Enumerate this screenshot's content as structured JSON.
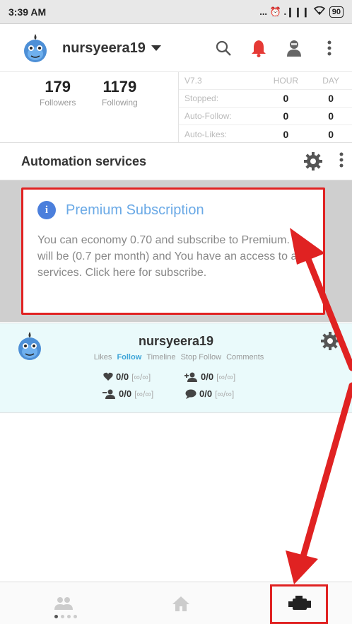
{
  "status_bar": {
    "time": "3:39 AM",
    "signal": "... ⏰ .❙❙❙",
    "battery": "90"
  },
  "header": {
    "username": "nursyeera19"
  },
  "stats": {
    "followers_count": "179",
    "followers_label": "Followers",
    "following_count": "1179",
    "following_label": "Following"
  },
  "table": {
    "version": "V7.3",
    "col_hour": "HOUR",
    "col_day": "DAY",
    "rows": [
      {
        "label": "Stopped:",
        "hour": "0",
        "day": "0"
      },
      {
        "label": "Auto-Follow:",
        "hour": "0",
        "day": "0"
      },
      {
        "label": "Auto-Likes:",
        "hour": "0",
        "day": "0"
      }
    ]
  },
  "section": {
    "title": "Automation services"
  },
  "premium": {
    "title": "Premium Subscription",
    "body": "You can economy 0.70 and subscribe to Premium. It will be (0.7 per month) and You have an access to all services. Click here for subscribe."
  },
  "account": {
    "username": "nursyeera19",
    "tabs": [
      "Likes",
      "Follow",
      "Timeline",
      "Stop Follow",
      "Comments"
    ],
    "active_tab": "Follow",
    "metrics": {
      "likes": "0/0",
      "likes_limit": "[∞/∞]",
      "follow": "0/0",
      "follow_limit": "[∞/∞]",
      "unfollow": "0/0",
      "unfollow_limit": "[∞/∞]",
      "comments": "0/0",
      "comments_limit": "[∞/∞]"
    }
  },
  "colors": {
    "accent_red": "#e02222",
    "link_blue": "#6aa9e6",
    "active_tab": "#3ea5d8",
    "bell_red": "#e53935"
  }
}
